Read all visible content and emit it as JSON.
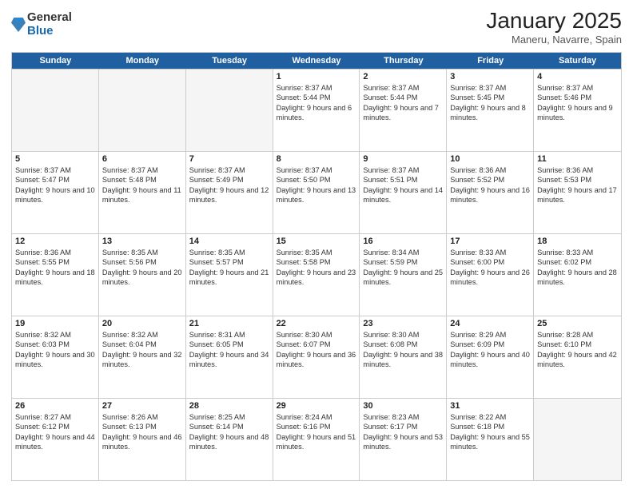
{
  "logo": {
    "general": "General",
    "blue": "Blue"
  },
  "title": "January 2025",
  "subtitle": "Maneru, Navarre, Spain",
  "header_days": [
    "Sunday",
    "Monday",
    "Tuesday",
    "Wednesday",
    "Thursday",
    "Friday",
    "Saturday"
  ],
  "weeks": [
    [
      {
        "day": "",
        "sunrise": "",
        "sunset": "",
        "daylight": "",
        "empty": true
      },
      {
        "day": "",
        "sunrise": "",
        "sunset": "",
        "daylight": "",
        "empty": true
      },
      {
        "day": "",
        "sunrise": "",
        "sunset": "",
        "daylight": "",
        "empty": true
      },
      {
        "day": "1",
        "sunrise": "Sunrise: 8:37 AM",
        "sunset": "Sunset: 5:44 PM",
        "daylight": "Daylight: 9 hours and 6 minutes.",
        "empty": false
      },
      {
        "day": "2",
        "sunrise": "Sunrise: 8:37 AM",
        "sunset": "Sunset: 5:44 PM",
        "daylight": "Daylight: 9 hours and 7 minutes.",
        "empty": false
      },
      {
        "day": "3",
        "sunrise": "Sunrise: 8:37 AM",
        "sunset": "Sunset: 5:45 PM",
        "daylight": "Daylight: 9 hours and 8 minutes.",
        "empty": false
      },
      {
        "day": "4",
        "sunrise": "Sunrise: 8:37 AM",
        "sunset": "Sunset: 5:46 PM",
        "daylight": "Daylight: 9 hours and 9 minutes.",
        "empty": false
      }
    ],
    [
      {
        "day": "5",
        "sunrise": "Sunrise: 8:37 AM",
        "sunset": "Sunset: 5:47 PM",
        "daylight": "Daylight: 9 hours and 10 minutes.",
        "empty": false
      },
      {
        "day": "6",
        "sunrise": "Sunrise: 8:37 AM",
        "sunset": "Sunset: 5:48 PM",
        "daylight": "Daylight: 9 hours and 11 minutes.",
        "empty": false
      },
      {
        "day": "7",
        "sunrise": "Sunrise: 8:37 AM",
        "sunset": "Sunset: 5:49 PM",
        "daylight": "Daylight: 9 hours and 12 minutes.",
        "empty": false
      },
      {
        "day": "8",
        "sunrise": "Sunrise: 8:37 AM",
        "sunset": "Sunset: 5:50 PM",
        "daylight": "Daylight: 9 hours and 13 minutes.",
        "empty": false
      },
      {
        "day": "9",
        "sunrise": "Sunrise: 8:37 AM",
        "sunset": "Sunset: 5:51 PM",
        "daylight": "Daylight: 9 hours and 14 minutes.",
        "empty": false
      },
      {
        "day": "10",
        "sunrise": "Sunrise: 8:36 AM",
        "sunset": "Sunset: 5:52 PM",
        "daylight": "Daylight: 9 hours and 16 minutes.",
        "empty": false
      },
      {
        "day": "11",
        "sunrise": "Sunrise: 8:36 AM",
        "sunset": "Sunset: 5:53 PM",
        "daylight": "Daylight: 9 hours and 17 minutes.",
        "empty": false
      }
    ],
    [
      {
        "day": "12",
        "sunrise": "Sunrise: 8:36 AM",
        "sunset": "Sunset: 5:55 PM",
        "daylight": "Daylight: 9 hours and 18 minutes.",
        "empty": false
      },
      {
        "day": "13",
        "sunrise": "Sunrise: 8:35 AM",
        "sunset": "Sunset: 5:56 PM",
        "daylight": "Daylight: 9 hours and 20 minutes.",
        "empty": false
      },
      {
        "day": "14",
        "sunrise": "Sunrise: 8:35 AM",
        "sunset": "Sunset: 5:57 PM",
        "daylight": "Daylight: 9 hours and 21 minutes.",
        "empty": false
      },
      {
        "day": "15",
        "sunrise": "Sunrise: 8:35 AM",
        "sunset": "Sunset: 5:58 PM",
        "daylight": "Daylight: 9 hours and 23 minutes.",
        "empty": false
      },
      {
        "day": "16",
        "sunrise": "Sunrise: 8:34 AM",
        "sunset": "Sunset: 5:59 PM",
        "daylight": "Daylight: 9 hours and 25 minutes.",
        "empty": false
      },
      {
        "day": "17",
        "sunrise": "Sunrise: 8:33 AM",
        "sunset": "Sunset: 6:00 PM",
        "daylight": "Daylight: 9 hours and 26 minutes.",
        "empty": false
      },
      {
        "day": "18",
        "sunrise": "Sunrise: 8:33 AM",
        "sunset": "Sunset: 6:02 PM",
        "daylight": "Daylight: 9 hours and 28 minutes.",
        "empty": false
      }
    ],
    [
      {
        "day": "19",
        "sunrise": "Sunrise: 8:32 AM",
        "sunset": "Sunset: 6:03 PM",
        "daylight": "Daylight: 9 hours and 30 minutes.",
        "empty": false
      },
      {
        "day": "20",
        "sunrise": "Sunrise: 8:32 AM",
        "sunset": "Sunset: 6:04 PM",
        "daylight": "Daylight: 9 hours and 32 minutes.",
        "empty": false
      },
      {
        "day": "21",
        "sunrise": "Sunrise: 8:31 AM",
        "sunset": "Sunset: 6:05 PM",
        "daylight": "Daylight: 9 hours and 34 minutes.",
        "empty": false
      },
      {
        "day": "22",
        "sunrise": "Sunrise: 8:30 AM",
        "sunset": "Sunset: 6:07 PM",
        "daylight": "Daylight: 9 hours and 36 minutes.",
        "empty": false
      },
      {
        "day": "23",
        "sunrise": "Sunrise: 8:30 AM",
        "sunset": "Sunset: 6:08 PM",
        "daylight": "Daylight: 9 hours and 38 minutes.",
        "empty": false
      },
      {
        "day": "24",
        "sunrise": "Sunrise: 8:29 AM",
        "sunset": "Sunset: 6:09 PM",
        "daylight": "Daylight: 9 hours and 40 minutes.",
        "empty": false
      },
      {
        "day": "25",
        "sunrise": "Sunrise: 8:28 AM",
        "sunset": "Sunset: 6:10 PM",
        "daylight": "Daylight: 9 hours and 42 minutes.",
        "empty": false
      }
    ],
    [
      {
        "day": "26",
        "sunrise": "Sunrise: 8:27 AM",
        "sunset": "Sunset: 6:12 PM",
        "daylight": "Daylight: 9 hours and 44 minutes.",
        "empty": false
      },
      {
        "day": "27",
        "sunrise": "Sunrise: 8:26 AM",
        "sunset": "Sunset: 6:13 PM",
        "daylight": "Daylight: 9 hours and 46 minutes.",
        "empty": false
      },
      {
        "day": "28",
        "sunrise": "Sunrise: 8:25 AM",
        "sunset": "Sunset: 6:14 PM",
        "daylight": "Daylight: 9 hours and 48 minutes.",
        "empty": false
      },
      {
        "day": "29",
        "sunrise": "Sunrise: 8:24 AM",
        "sunset": "Sunset: 6:16 PM",
        "daylight": "Daylight: 9 hours and 51 minutes.",
        "empty": false
      },
      {
        "day": "30",
        "sunrise": "Sunrise: 8:23 AM",
        "sunset": "Sunset: 6:17 PM",
        "daylight": "Daylight: 9 hours and 53 minutes.",
        "empty": false
      },
      {
        "day": "31",
        "sunrise": "Sunrise: 8:22 AM",
        "sunset": "Sunset: 6:18 PM",
        "daylight": "Daylight: 9 hours and 55 minutes.",
        "empty": false
      },
      {
        "day": "",
        "sunrise": "",
        "sunset": "",
        "daylight": "",
        "empty": true
      }
    ]
  ]
}
